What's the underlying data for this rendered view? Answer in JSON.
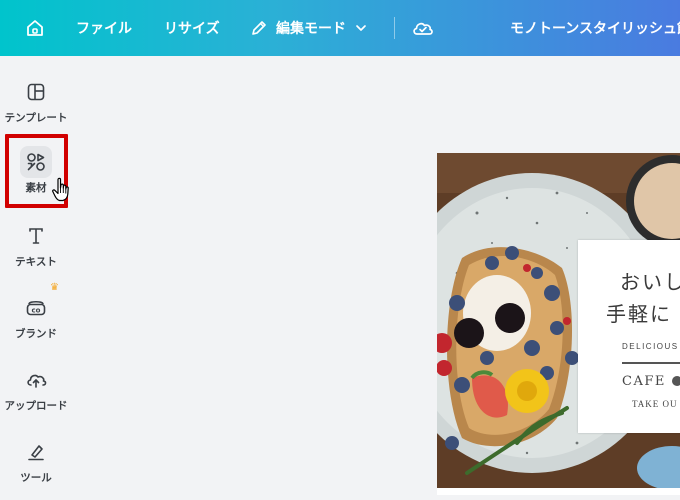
{
  "topbar": {
    "home_icon": "home-icon",
    "file_label": "ファイル",
    "resize_label": "リサイズ",
    "edit_icon": "pencil-icon",
    "edit_label": "編集モード",
    "edit_chevron_icon": "chevron-down-icon",
    "cloud_icon": "cloud-check-icon",
    "document_title": "モノトーンスタイリッシュ飲"
  },
  "sidebar": {
    "items": [
      {
        "id": "templates",
        "label": "テンプレート",
        "icon": "layout-icon"
      },
      {
        "id": "elements",
        "label": "素材",
        "icon": "shapes-icon"
      },
      {
        "id": "text",
        "label": "テキスト",
        "icon": "text-icon"
      },
      {
        "id": "brand",
        "label": "ブランド",
        "icon": "brand-icon",
        "badge_icon": "crown-icon"
      },
      {
        "id": "uploads",
        "label": "アップロード",
        "icon": "cloud-upload-icon"
      },
      {
        "id": "tools",
        "label": "ツール",
        "icon": "pen-tool-icon"
      }
    ]
  },
  "design": {
    "headline_line1": "おいし",
    "headline_line2": "手軽に",
    "subtext": "DELICIOUS",
    "cafe_label": "CAFE",
    "take_label": "TAKE OU"
  },
  "colors": {
    "topbar_gradient_start": "#00c4cc",
    "topbar_gradient_end": "#4a7be0",
    "highlight": "#d10000",
    "crown": "#f5a623",
    "sidebar_bg": "#f2f3f5"
  }
}
